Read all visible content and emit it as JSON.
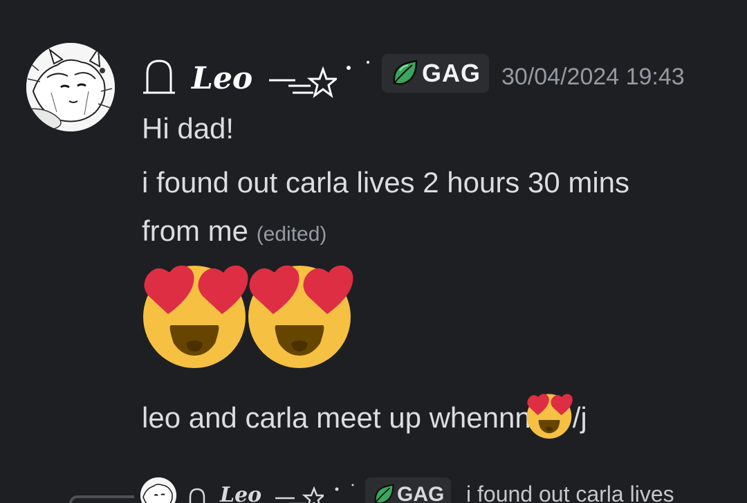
{
  "message": {
    "username": "Leo",
    "tag": "GAG",
    "timestamp": "30/04/2024 19:43",
    "lines": [
      "Hi dad!",
      "i found out carla lives 2 hours 30 mins",
      "from me",
      "leo and carla meet up whennn",
      "/j"
    ],
    "edited_label": "(edited)",
    "emojis": [
      "heart-eyes-face",
      "heart-eyes-face"
    ]
  },
  "reply_preview": {
    "username": "Leo",
    "tag": "GAG",
    "text": "i found out carla lives"
  },
  "colors": {
    "background": "#1e1f22",
    "text": "#dbdee1",
    "muted": "#949ba4",
    "badge_bg": "#2b2d31",
    "leaf_green": "#3ba55d",
    "emoji_yellow": "#f6c142",
    "heart_red": "#dd2e44"
  },
  "icons": [
    "tombstone-icon",
    "star-trail-icon",
    "leaf-icon",
    "heart-eyes-emoji"
  ]
}
